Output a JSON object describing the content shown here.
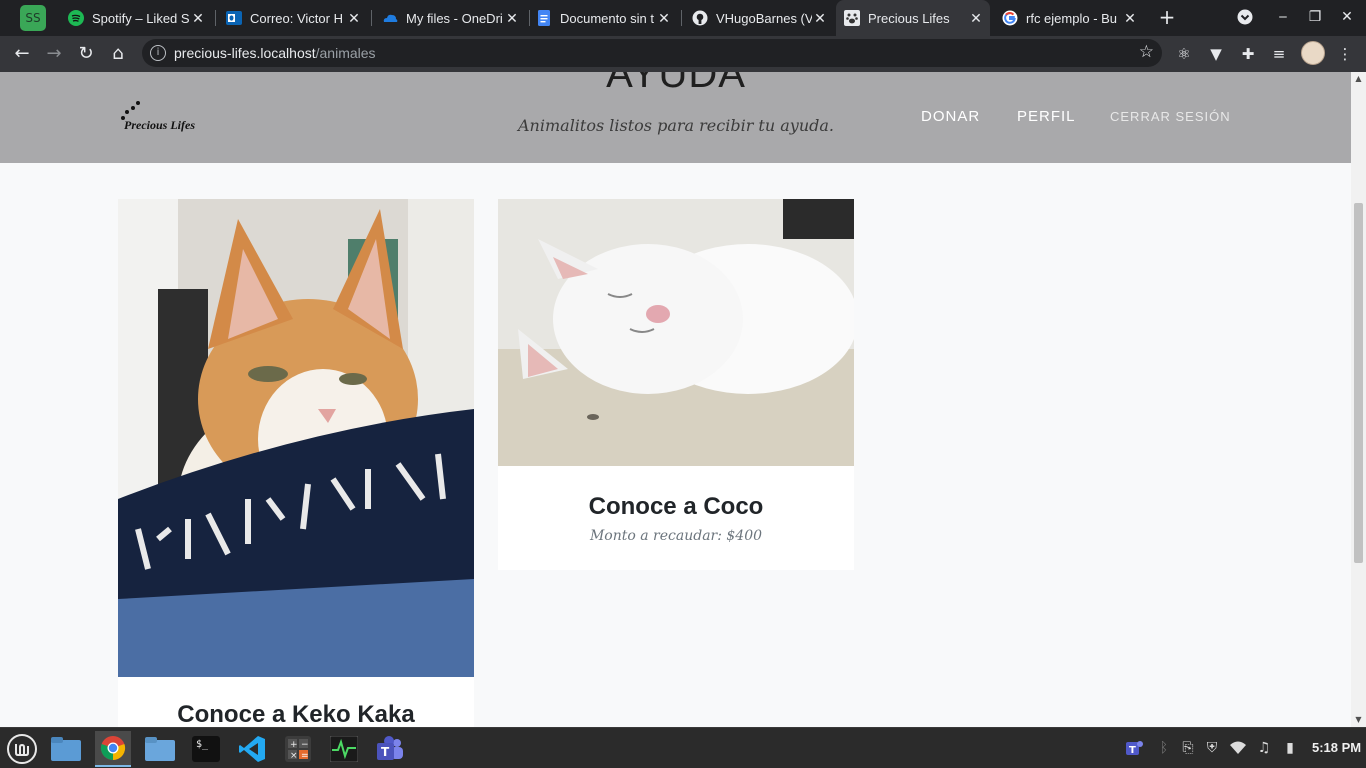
{
  "browser": {
    "profile_badge": "SS",
    "tabs": [
      {
        "title": "Spotify – Liked S",
        "favicon": "spotify-icon"
      },
      {
        "title": "Correo: Victor H",
        "favicon": "outlook-icon"
      },
      {
        "title": "My files - OneDri",
        "favicon": "onedrive-icon"
      },
      {
        "title": "Documento sin t",
        "favicon": "google-docs-icon"
      },
      {
        "title": "VHugoBarnes (V",
        "favicon": "github-icon"
      },
      {
        "title": "Precious Lifes",
        "favicon": "paw-icon",
        "active": true
      },
      {
        "title": "rfc ejemplo - Bu",
        "favicon": "google-icon"
      }
    ],
    "address": {
      "host": "precious-lifes.localhost",
      "path": "/animales"
    }
  },
  "page": {
    "brand": "Precious Lifes",
    "hero_title": "AYUDA",
    "hero_subtitle": "Animalitos listos para recibir tu ayuda.",
    "nav": {
      "donate": "DONAR",
      "profile": "PERFIL",
      "logout": "CERRAR SESIÓN"
    },
    "cards": [
      {
        "title": "Conoce a Keko Kaka",
        "amount_label": ""
      },
      {
        "title": "Conoce a Coco",
        "amount_label": "Monto a recaudar: $400"
      }
    ]
  },
  "taskbar": {
    "clock": "5:18 PM",
    "apps": [
      "mint-menu-icon",
      "files-icon",
      "chrome-icon",
      "folder-icon",
      "terminal-icon",
      "vscode-icon",
      "calculator-icon",
      "system-monitor-icon",
      "teams-icon"
    ]
  },
  "colors": {
    "header_bg": "#a9a9ab",
    "page_bg": "#f8f9fa",
    "tab_bg": "#202124",
    "toolbar_bg": "#35363a"
  }
}
